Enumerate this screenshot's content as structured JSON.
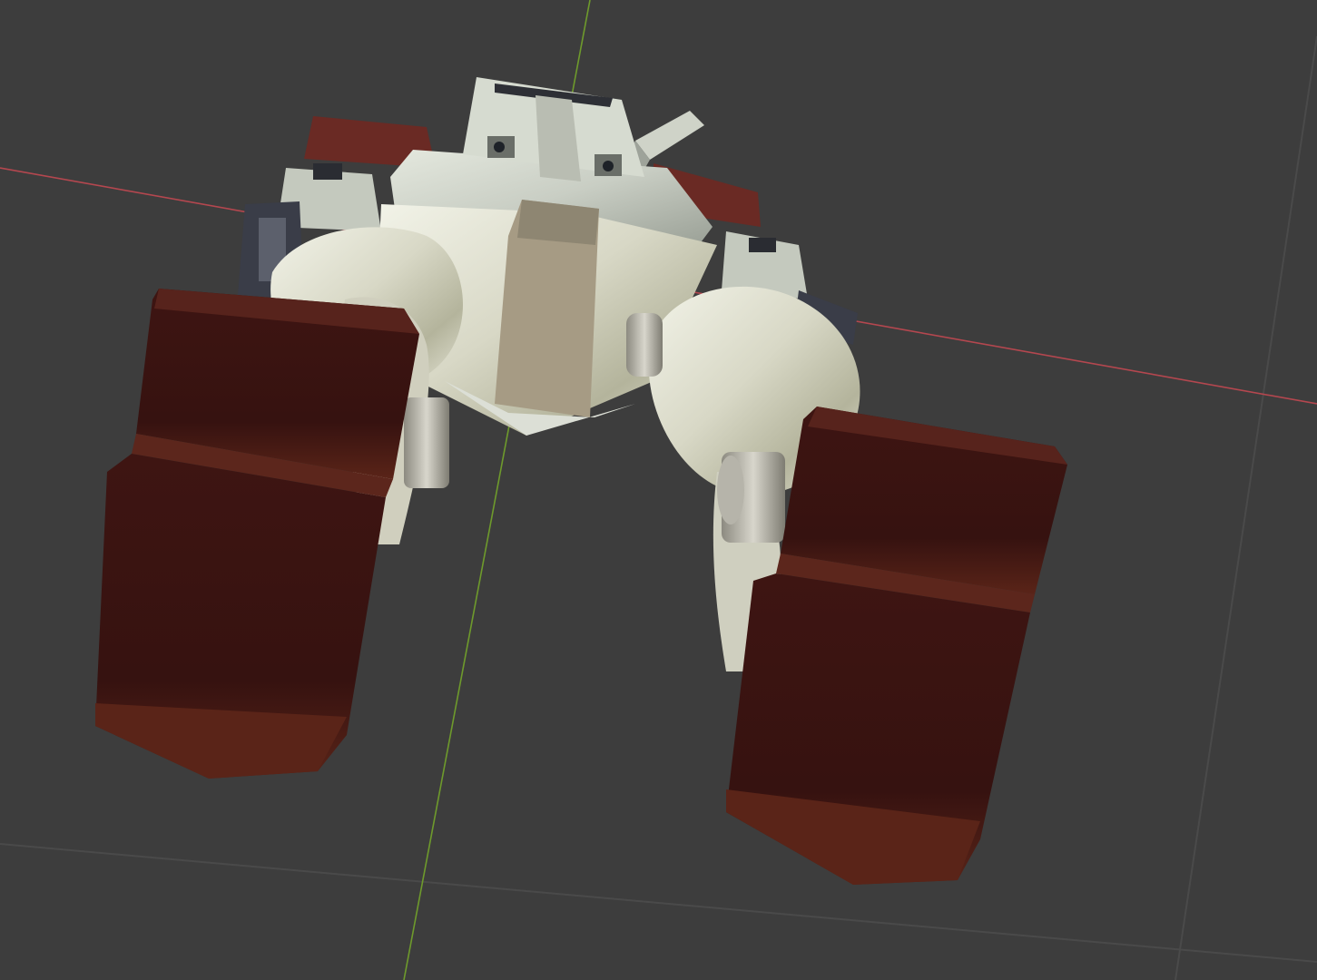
{
  "viewport": {
    "background": "#3d3d3d",
    "grid_color": "#4a4a4a",
    "x_axis_color": "#b4474f",
    "y_axis_color": "#6e9a2c"
  },
  "model": {
    "hull_color": "#c9cec4",
    "armor_color": "#3b1410",
    "armor_edge_color": "#6a2a20",
    "dark_panel_color": "#3a3d48"
  }
}
